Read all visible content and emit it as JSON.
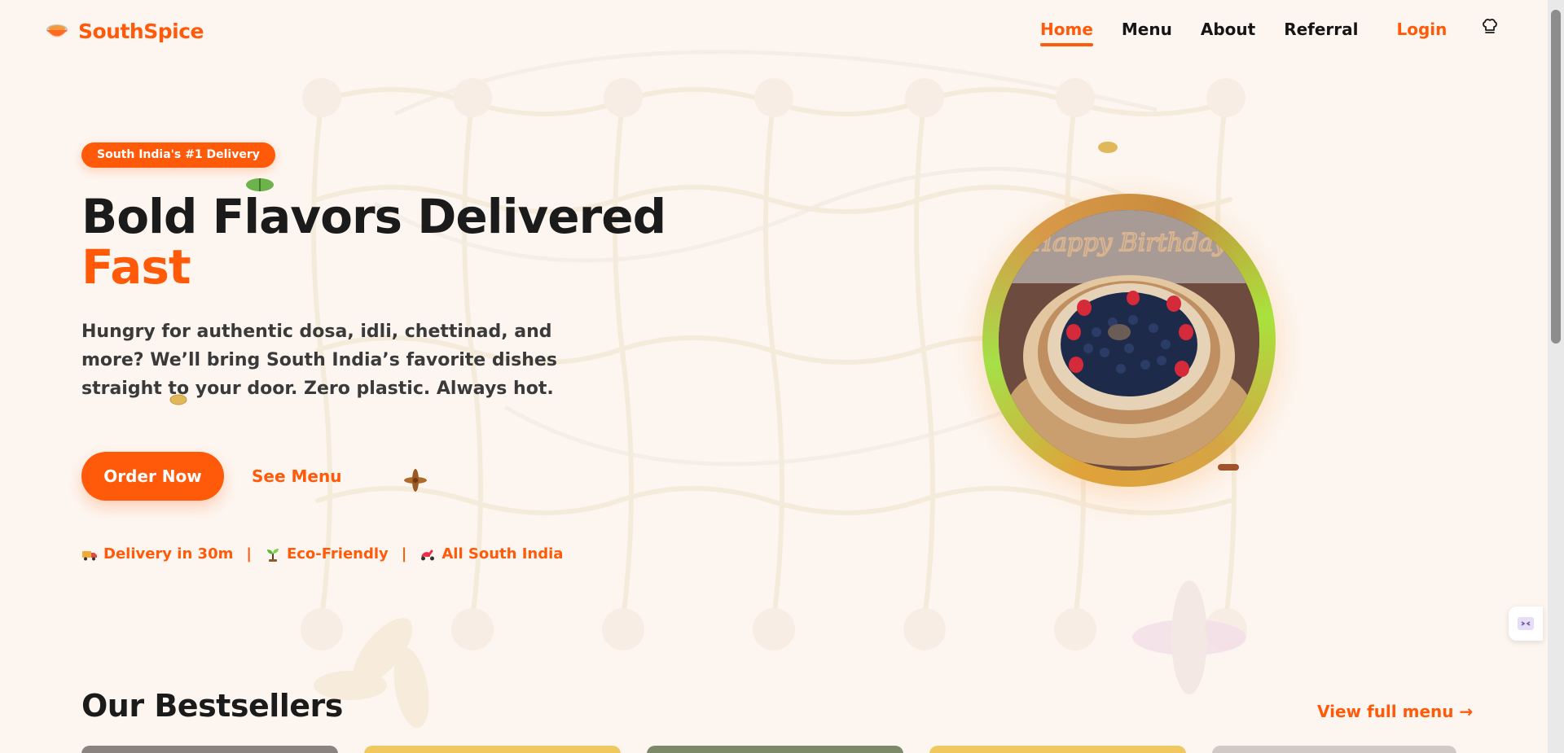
{
  "brand": {
    "name": "SouthSpice",
    "logo_icon": "bowl-icon"
  },
  "nav": {
    "items": [
      {
        "label": "Home",
        "active": true
      },
      {
        "label": "Menu",
        "active": false
      },
      {
        "label": "About",
        "active": false
      },
      {
        "label": "Referral",
        "active": false
      }
    ],
    "login_label": "Login",
    "profile_icon": "chef-hat-icon"
  },
  "hero": {
    "badge": "South India's #1 Delivery",
    "title_line1": "Bold Flavors Delivered",
    "title_line2": "Fast",
    "description": "Hungry for authentic dosa, idli, chettinad, and more? We’ll bring South India’s favorite dishes straight to your door. Zero plastic. Always hot.",
    "cta_primary": "Order Now",
    "cta_secondary": "See Menu",
    "features": [
      {
        "icon": "delivery-truck-icon",
        "label": "Delivery in 30m"
      },
      {
        "icon": "seedling-icon",
        "label": "Eco-Friendly"
      },
      {
        "icon": "scooter-icon",
        "label": "All South India"
      }
    ],
    "separator": "|",
    "image": {
      "subject": "birthday-cake-photo",
      "topper_text": "Happy Birthday"
    }
  },
  "bestsellers": {
    "title": "Our Bestsellers",
    "view_all": "View full menu →"
  },
  "colors": {
    "accent": "#ff5a0a",
    "background": "#fdf6f0",
    "text": "#1b1b1b"
  }
}
